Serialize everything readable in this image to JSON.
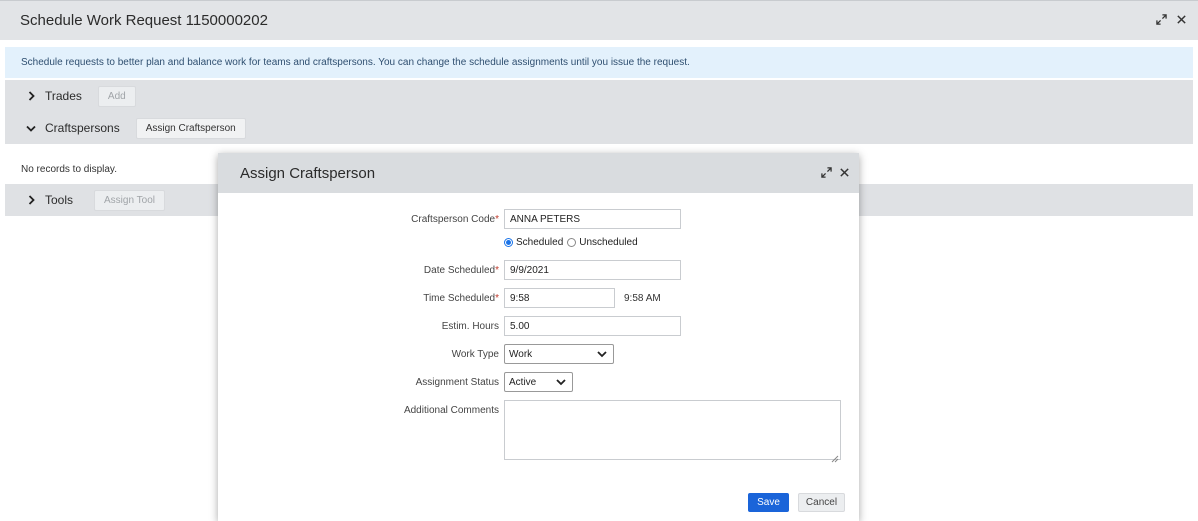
{
  "page": {
    "title": "Schedule Work Request 1150000202",
    "info": "Schedule requests to better plan and balance work for teams and craftspersons. You can change the schedule assignments until you issue the request."
  },
  "sections": {
    "trades": {
      "label": "Trades",
      "button": "Add"
    },
    "craftspersons": {
      "label": "Craftspersons",
      "button": "Assign Craftsperson",
      "empty": "No records to display."
    },
    "tools": {
      "label": "Tools",
      "button": "Assign Tool"
    }
  },
  "dialog": {
    "title": "Assign Craftsperson",
    "fields": {
      "craftsperson_code": {
        "label": "Craftsperson Code",
        "value": "ANNA PETERS"
      },
      "schedule_options": {
        "scheduled": "Scheduled",
        "unscheduled": "Unscheduled",
        "selected": "Scheduled"
      },
      "date_scheduled": {
        "label": "Date Scheduled",
        "value": "9/9/2021"
      },
      "time_scheduled": {
        "label": "Time Scheduled",
        "value": "9:58",
        "display": "9:58 AM"
      },
      "estim_hours": {
        "label": "Estim. Hours",
        "value": "5.00"
      },
      "work_type": {
        "label": "Work Type",
        "value": "Work"
      },
      "assignment_status": {
        "label": "Assignment Status",
        "value": "Active"
      },
      "additional_comments": {
        "label": "Additional Comments",
        "value": ""
      }
    },
    "required_marker": "*",
    "save_label": "Save",
    "cancel_label": "Cancel"
  },
  "colors": {
    "primary": "#1a64d9",
    "info_bg": "#e3f1fc",
    "section_bg": "#dfe1e4"
  },
  "icons": [
    "expand-icon",
    "close-icon",
    "chevron-right-icon",
    "chevron-down-icon",
    "select-arrow-icon",
    "resize-grip-icon"
  ]
}
